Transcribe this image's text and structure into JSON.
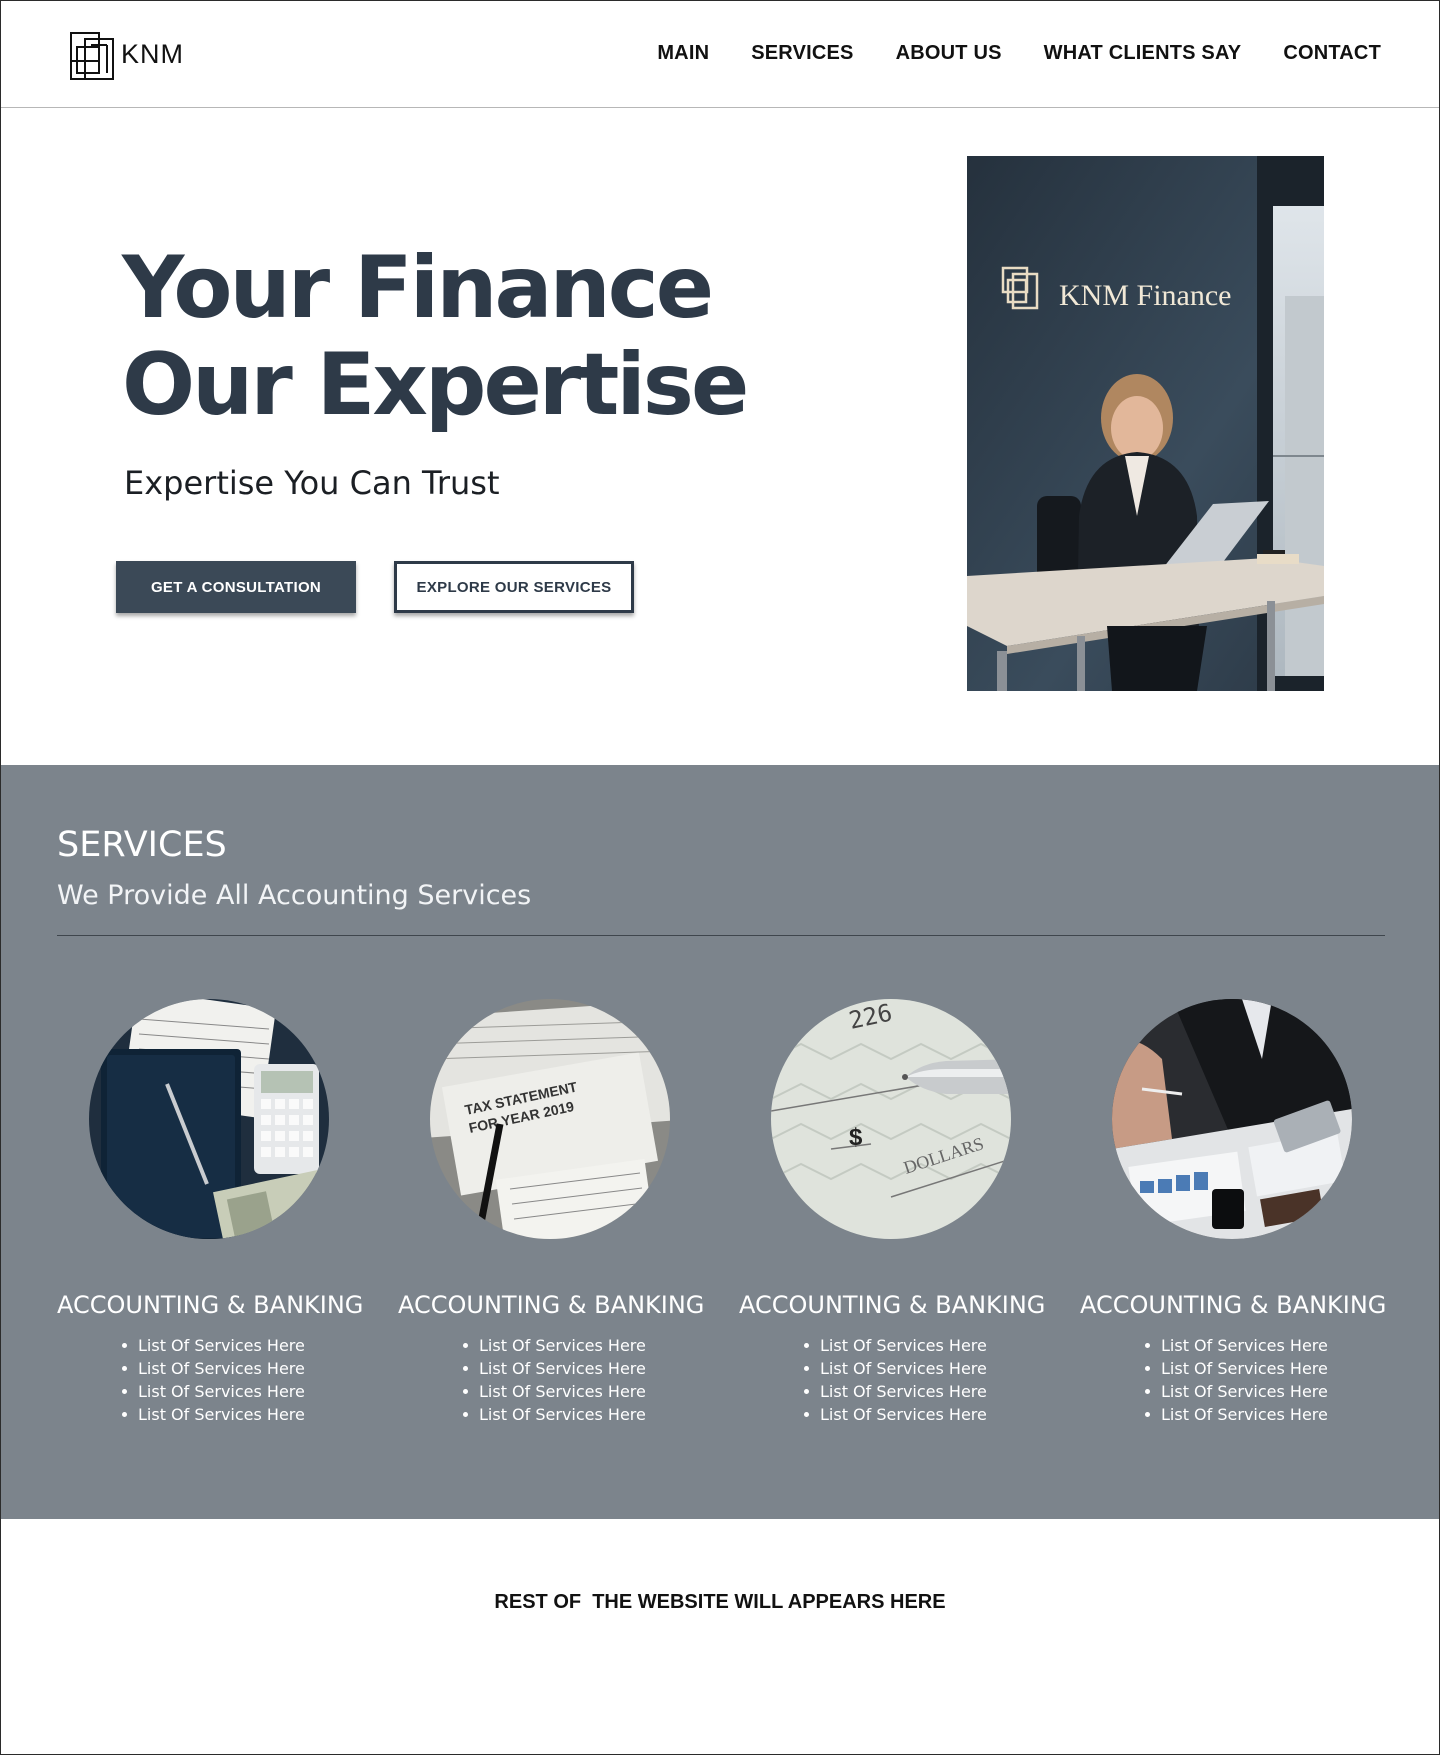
{
  "brand": {
    "name": "KNM",
    "logo_icon": "overlapping-squares-logo"
  },
  "nav": {
    "items": [
      "MAIN",
      "SERVICES",
      "ABOUT US",
      "WHAT CLIENTS SAY",
      "CONTACT"
    ]
  },
  "hero": {
    "title_line1": "Your Finance",
    "title_line2": "Our Expertise",
    "subtitle": "Expertise You Can Trust",
    "primary_button": "GET A CONSULTATION",
    "secondary_button": "EXPLORE OUR SERVICES",
    "photo_sign": "KNM Finance"
  },
  "services": {
    "title": "SERVICES",
    "subtitle": "We Provide All Accounting Services",
    "cards": [
      {
        "title": "ACCOUNTING & BANKING",
        "items": [
          "List Of Services Here",
          "List Of Services Here",
          "List Of Services Here",
          "List Of Services Here"
        ]
      },
      {
        "title": "ACCOUNTING & BANKING",
        "items": [
          "List Of Services Here",
          "List Of Services Here",
          "List Of Services Here",
          "List Of Services Here"
        ]
      },
      {
        "title": "ACCOUNTING & BANKING",
        "items": [
          "List Of Services Here",
          "List Of Services Here",
          "List Of Services Here",
          "List Of Services Here"
        ]
      },
      {
        "title": "ACCOUNTING & BANKING",
        "items": [
          "List Of Services Here",
          "List Of Services Here",
          "List Of Services Here",
          "List Of Services Here"
        ]
      }
    ]
  },
  "image_text": {
    "tax_statement": "TAX STATEMENT",
    "tax_year": "FOR YEAR 2019",
    "check_number": "226",
    "check_dollars": "DOLLARS"
  },
  "footer_note": "REST OF  THE WEBSITE WILL APPEARS HERE",
  "colors": {
    "primary": "#3b4957",
    "heading": "#2e3a48",
    "services_bg": "#7c848c"
  }
}
